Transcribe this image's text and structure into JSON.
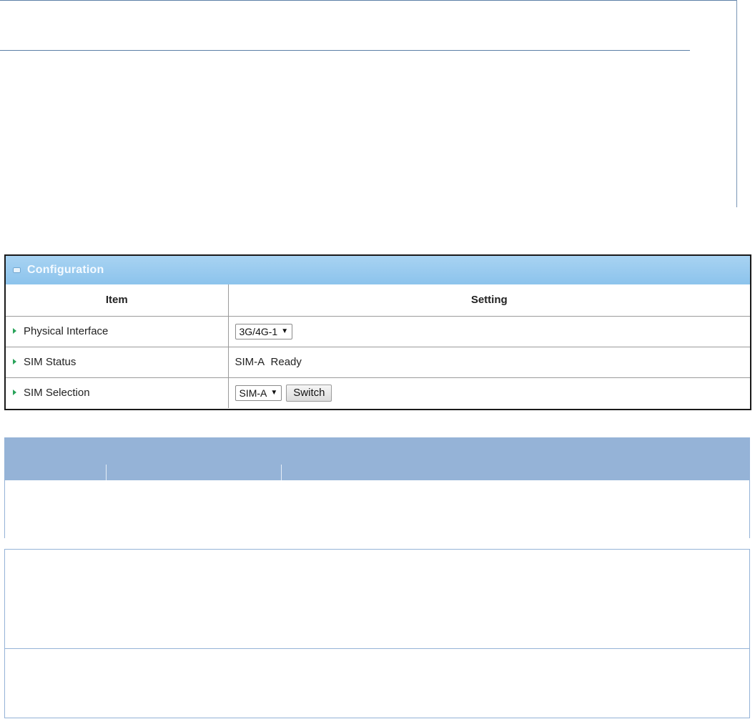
{
  "config": {
    "title": "Configuration",
    "columns": {
      "item": "Item",
      "setting": "Setting"
    },
    "rows": {
      "physical_interface": {
        "label": "Physical Interface",
        "value": "3G/4G-1"
      },
      "sim_status": {
        "label": "SIM Status",
        "sim": "SIM-A",
        "status": "Ready"
      },
      "sim_selection": {
        "label": "SIM Selection",
        "value": "SIM-A",
        "button": "Switch"
      }
    }
  },
  "colors": {
    "panel_header": "#8cc3ec",
    "desc_header": "#95b3d7",
    "row_arrow": "#29a35a"
  },
  "icons": {
    "header": "panel-icon",
    "row_marker": "triangle-right-icon",
    "dropdown": "caret-down-icon"
  }
}
